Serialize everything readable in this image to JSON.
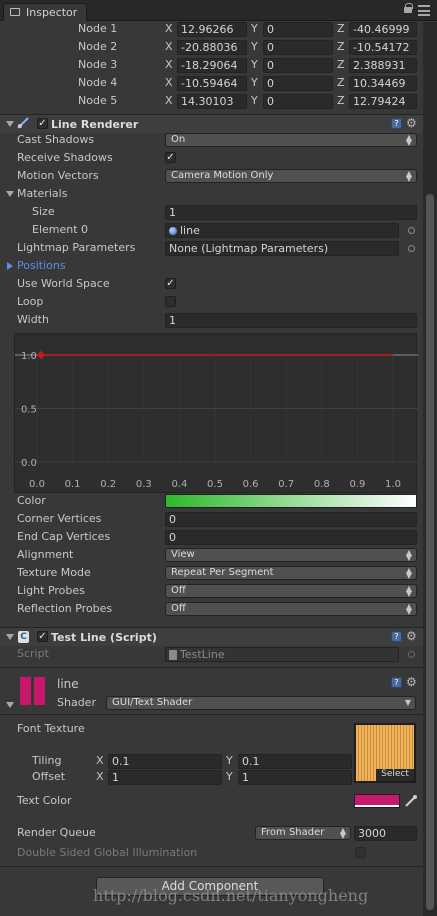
{
  "tab": {
    "title": "Inspector"
  },
  "nodes": [
    {
      "label": "Node 1",
      "x": "12.96266",
      "y": "0",
      "z": "-40.46999"
    },
    {
      "label": "Node 2",
      "x": "-20.88036",
      "y": "0",
      "z": "-10.54172"
    },
    {
      "label": "Node 3",
      "x": "-18.29064",
      "y": "0",
      "z": "2.388931"
    },
    {
      "label": "Node 4",
      "x": "-10.59464",
      "y": "0",
      "z": "10.34469"
    },
    {
      "label": "Node 5",
      "x": "14.30103",
      "y": "0",
      "z": "12.79424"
    }
  ],
  "axis_labels": {
    "x": "X",
    "y": "Y",
    "z": "Z"
  },
  "line_renderer": {
    "title": "Line Renderer",
    "cast_shadows": {
      "label": "Cast Shadows",
      "value": "On"
    },
    "receive_shadows": {
      "label": "Receive Shadows",
      "checked": true
    },
    "motion_vectors": {
      "label": "Motion Vectors",
      "value": "Camera Motion Only"
    },
    "materials": {
      "label": "Materials",
      "size_label": "Size",
      "size_value": "1",
      "element_label": "Element 0",
      "element_value": "line"
    },
    "lightmap": {
      "label": "Lightmap Parameters",
      "value": "None (Lightmap Parameters)"
    },
    "positions": {
      "label": "Positions"
    },
    "use_world_space": {
      "label": "Use World Space",
      "checked": true
    },
    "loop": {
      "label": "Loop",
      "checked": false
    },
    "width": {
      "label": "Width",
      "value": "1"
    },
    "curve": {
      "y_ticks": [
        "1.0",
        "0.5",
        "0.0"
      ],
      "x_ticks": [
        "0.0",
        "0.1",
        "0.2",
        "0.3",
        "0.4",
        "0.5",
        "0.6",
        "0.7",
        "0.8",
        "0.9",
        "1.0"
      ],
      "line_color": "#c81818",
      "value": 1.0
    },
    "color": {
      "label": "Color",
      "gradient_start": "#2db82d",
      "gradient_end": "#ffffff"
    },
    "corner_vertices": {
      "label": "Corner Vertices",
      "value": "0"
    },
    "end_cap_vertices": {
      "label": "End Cap Vertices",
      "value": "0"
    },
    "alignment": {
      "label": "Alignment",
      "value": "View"
    },
    "texture_mode": {
      "label": "Texture Mode",
      "value": "Repeat Per Segment"
    },
    "light_probes": {
      "label": "Light Probes",
      "value": "Off"
    },
    "reflection_probes": {
      "label": "Reflection Probes",
      "value": "Off"
    }
  },
  "test_line": {
    "title": "Test Line (Script)",
    "script_label": "Script",
    "script_value": "TestLine"
  },
  "material": {
    "name": "line",
    "color": "#c8186e",
    "shader_label": "Shader",
    "shader_value": "GUI/Text Shader",
    "font_texture_label": "Font Texture",
    "tiling_label": "Tiling",
    "tiling_x": "0.1",
    "tiling_y": "0.1",
    "offset_label": "Offset",
    "offset_x": "1",
    "offset_y": "1",
    "select_label": "Select",
    "text_color_label": "Text Color",
    "text_color": "#c8186e",
    "render_queue_label": "Render Queue",
    "render_queue_mode": "From Shader",
    "render_queue_value": "3000",
    "double_sided_label": "Double Sided Global Illumination"
  },
  "add_component": {
    "label": "Add Component"
  },
  "watermark": {
    "text": "http://blog.csdn.net/tianyongheng"
  },
  "icons": {
    "help": "?",
    "gear": "⚙",
    "check": "✓"
  }
}
